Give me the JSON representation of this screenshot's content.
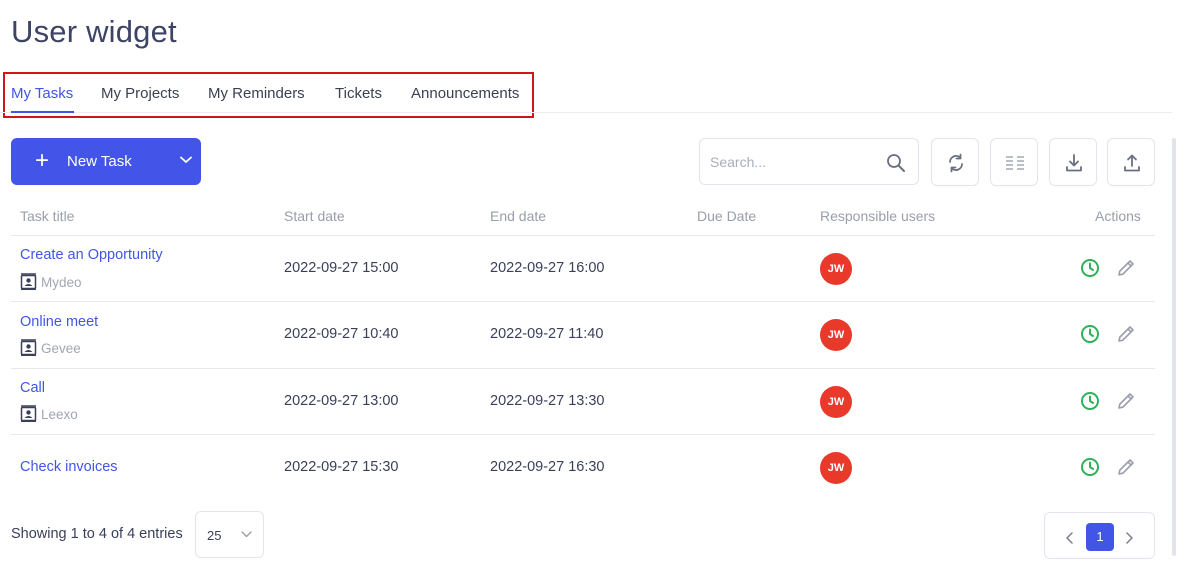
{
  "page_title": "User widget",
  "tabs": [
    {
      "label": "My Tasks",
      "active": true
    },
    {
      "label": "My Projects",
      "active": false
    },
    {
      "label": "My Reminders",
      "active": false
    },
    {
      "label": "Tickets",
      "active": false
    },
    {
      "label": "Announcements",
      "active": false
    }
  ],
  "toolbar": {
    "new_task_label": "New Task",
    "search_placeholder": "Search...",
    "icons": [
      "refresh-icon",
      "columns-icon",
      "download-icon",
      "upload-icon"
    ]
  },
  "table": {
    "headers": [
      "Task title",
      "Start date",
      "End date",
      "Due Date",
      "Responsible users",
      "Actions"
    ],
    "rows": [
      {
        "title": "Create an Opportunity",
        "company": "Mydeo",
        "start": "2022-09-27 15:00",
        "end": "2022-09-27 16:00",
        "due": "",
        "user": "JW"
      },
      {
        "title": "Online meet",
        "company": "Gevee",
        "start": "2022-09-27 10:40",
        "end": "2022-09-27 11:40",
        "due": "",
        "user": "JW"
      },
      {
        "title": "Call",
        "company": "Leexo",
        "start": "2022-09-27 13:00",
        "end": "2022-09-27 13:30",
        "due": "",
        "user": "JW"
      },
      {
        "title": "Check invoices",
        "company": "",
        "start": "2022-09-27 15:30",
        "end": "2022-09-27 16:30",
        "due": "",
        "user": "JW"
      }
    ]
  },
  "footer": {
    "showing_text": "Showing 1 to 4 of 4 entries",
    "page_size": "25",
    "current_page": "1"
  },
  "colors": {
    "accent": "#4255e8",
    "avatar": "#e8392a",
    "clock": "#2eb15a",
    "highlight_border": "#d0161c"
  }
}
